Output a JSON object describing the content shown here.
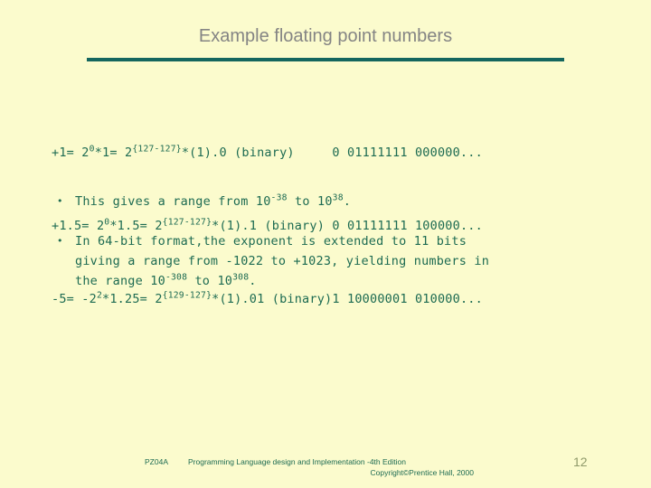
{
  "slide": {
    "title": "Example floating point numbers",
    "page_number": "12",
    "colors": {
      "background": "#fbfbcd",
      "title_text": "#848484",
      "rule": "#14665e",
      "body_text": "#1d6b52",
      "page_number": "#8f9a6a"
    }
  },
  "code_block": {
    "lines": [
      {
        "p1": "+1= 2",
        "sup1": "0",
        "p2": "*1= 2",
        "sup2": "{127-127}",
        "p3": "*(1).0 (binary)     0 01111111 000000..."
      },
      {
        "p1": "+1.5= 2",
        "sup1": "0",
        "p2": "*1.5= 2",
        "sup2": "{127-127}",
        "p3": "*(1).1 (binary) 0 01111111 100000..."
      },
      {
        "p1": "-5= -2",
        "sup1": "2",
        "p2": "*1.25= 2",
        "sup2": "{129-127}",
        "p3": "*(1).01 (binary)1 10000001 010000..."
      }
    ]
  },
  "bullets": [
    {
      "marker": "•",
      "p1": "This gives a range from 10",
      "sup1": "-38",
      "p2": " to 10",
      "sup2": "38",
      "p3": "."
    },
    {
      "marker": "•",
      "line1": "In 64-bit format,the exponent is extended to 11 bits",
      "line2": "giving a range from -1022 to +1023, yielding numbers in",
      "p1": "the range 10",
      "sup1": "-308",
      "p2": " to 10",
      "sup2": "308",
      "p3": "."
    }
  ],
  "footer": {
    "tag": "PZ04A",
    "line1": "Programming Language design and Implementation -4th Edition",
    "line2": "Copyright©Prentice Hall, 2000"
  }
}
